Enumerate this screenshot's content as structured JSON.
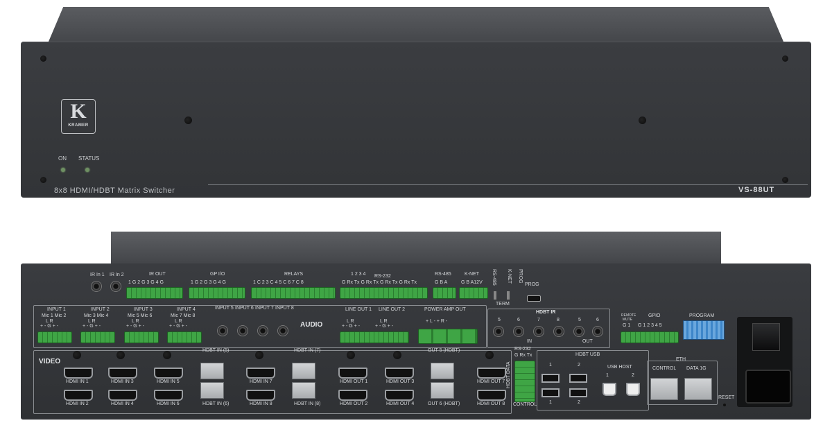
{
  "front": {
    "brand": "KRAMER",
    "led_on": "ON",
    "led_status": "STATUS",
    "description": "8x8 HDMI/HDBT Matrix Switcher",
    "model": "VS-88UT"
  },
  "rear": {
    "ir_in_1": "IR In 1",
    "ir_in_2": "IR In 2",
    "ir_out": "IR OUT",
    "ir_out_pins": "1 G 2 G  3 G 4 G",
    "gpio_top": "GP I/O",
    "gpio_top_pins": "1 G 2 G  3 G 4 G",
    "relays": "RELAYS",
    "relays_pins": "1 C 2  3 C 4  5 C 6  7 C 8",
    "rs232": "RS-232",
    "rs232_pins": "G Rx Tx  G Rx Tx  G Rx Tx  G Rx Tx",
    "rs232_nums": "1     2     3     4",
    "rs485": "RS-485",
    "rs485_pins": "G B A",
    "knet": "K-NET",
    "knet_pins": "G B  A12V",
    "vert_rs485": "RS-485",
    "vert_knet": "K-NET",
    "vert_prog": "PROG",
    "term": "TERM",
    "prog": "PROG",
    "input1": "INPUT 1",
    "input2": "INPUT 2",
    "input3": "INPUT 3",
    "input4": "INPUT 4",
    "mic12": "Mic 1  Mic 2",
    "mic34": "Mic 3  Mic 4",
    "mic56": "Mic 5  Mic 6",
    "mic78": "Mic 7  Mic 8",
    "lr_pins": "L     R",
    "pm_pins": "+ -  G  + -",
    "in5": "INPUT 5",
    "in6": "INPUT 6",
    "in7": "INPUT 7",
    "in8": "INPUT 8",
    "audio": "AUDIO",
    "lineout1": "LINE OUT 1",
    "lineout2": "LINE OUT 2",
    "poweramp": "POWER AMP OUT",
    "poweramp_pins": "+ L -   + R -",
    "hdbt_ir": "HDBT IR",
    "hdbt_ir_in": "IN",
    "hdbt_ir_out": "OUT",
    "ir_nums": [
      "5",
      "6",
      "7",
      "8",
      "5",
      "6"
    ],
    "remote_mute": "REMOTE MUTE",
    "remote_mute_pins": "G 1",
    "gpio": "GPIO",
    "gpio_pins": "G 1 2 3 4 5",
    "program": "PROGRAM",
    "video": "VIDEO",
    "hdmi_in_1": "HDMI IN 1",
    "hdmi_in_2": "HDMI IN 2",
    "hdmi_in_3": "HDMI IN 3",
    "hdmi_in_4": "HDMI IN 4",
    "hdmi_in_5": "HDMI IN 5",
    "hdmi_in_6": "HDMI IN 6",
    "hdmi_in_7": "HDMI IN 7",
    "hdmi_in_8": "HDMI IN 8",
    "hdbt_in_5": "HDBT IN (5)",
    "hdbt_in_6": "HDBT IN (6)",
    "hdbt_in_7": "HDBT IN (7)",
    "hdbt_in_8": "HDBT IN (8)",
    "hdmi_out_1": "HDMI OUT 1",
    "hdmi_out_2": "HDMI OUT 2",
    "hdmi_out_3": "HDMI OUT 3",
    "hdmi_out_4": "HDMI OUT 4",
    "hdmi_out_7": "HDMI OUT 7",
    "hdmi_out_8": "HDMI OUT 8",
    "out5_hdbt": "OUT 5 (HDBT)",
    "out6_hdbt": "OUT 6 (HDBT)",
    "hdbt_data": "HDBT DATA",
    "rs232_small": "RS-232",
    "rs232_small_pins": "G Rx Tx",
    "control": "CONTROL",
    "hdbt_usb": "HDBT USB",
    "usb_1": "1",
    "usb_2": "2",
    "usb_host": "USB HOST",
    "eth": "ETH",
    "eth_control": "CONTROL",
    "eth_data": "DATA 1G",
    "reset": "RESET"
  }
}
